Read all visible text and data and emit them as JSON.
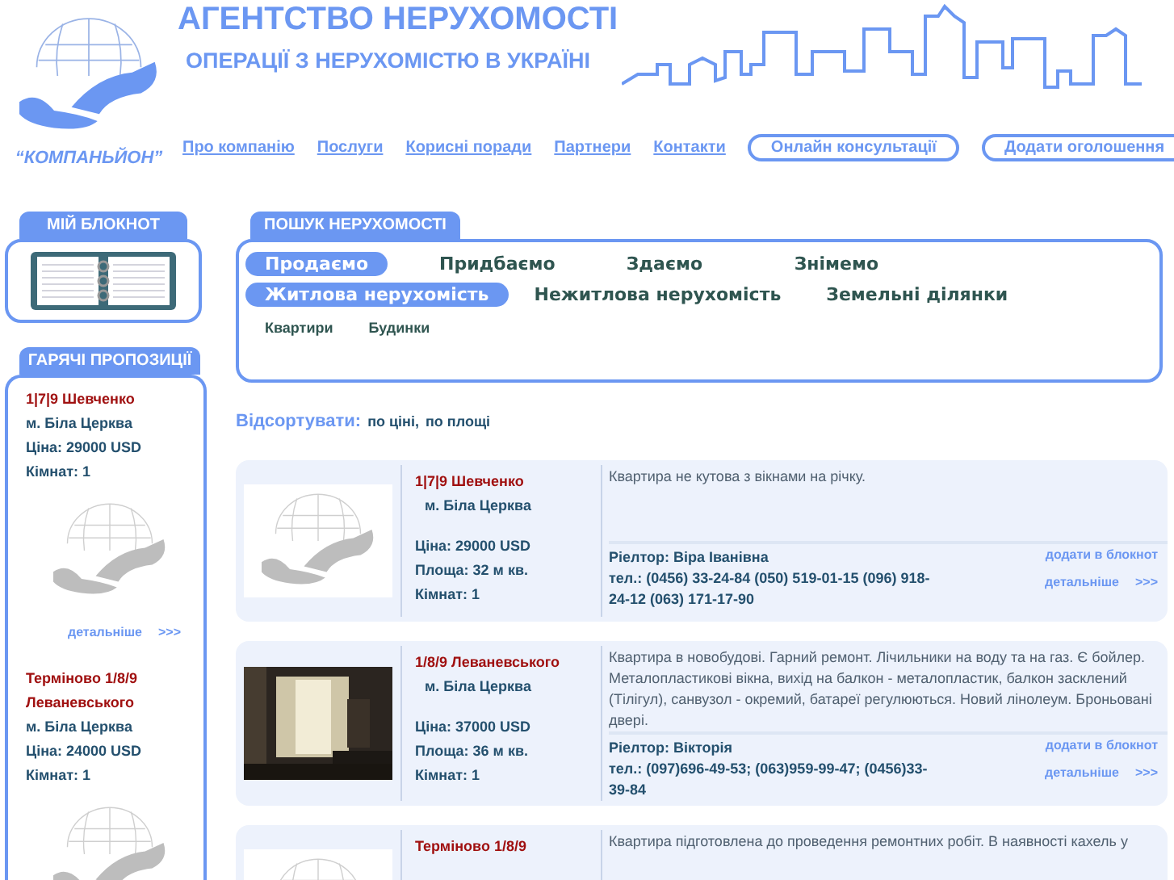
{
  "header": {
    "logo_text": "“КОМПАНЬЙОН”",
    "title": "АГЕНТСТВО НЕРУХОМОСТІ",
    "subtitle": "ОПЕРАЦІЇ З НЕРУХОМІСТЮ В УКРАЇНІ",
    "nav": [
      "Про компанію",
      "Послуги",
      "Корисні поради",
      "Партнери",
      "Контакти"
    ],
    "buttons": [
      "Онлайн консультації",
      "Додати оголошення"
    ]
  },
  "notebook": {
    "title": "МІЙ БЛОКНОТ"
  },
  "hot": {
    "title": "ГАРЯЧІ ПРОПОЗИЦІЇ",
    "items": [
      {
        "title": "1|7|9 Шевченко",
        "city": "м. Біла Церква",
        "price": "Ціна: 29000 USD",
        "rooms": "Кімнат: 1",
        "kind": "placeholder",
        "more": "детальніше",
        "arrows": ">>>"
      },
      {
        "title": "Терміново 1/8/9 Леваневського",
        "city": "м. Біла Церква",
        "price": "Ціна: 24000 USD",
        "rooms": "Кімнат: 1",
        "kind": "placeholder"
      }
    ]
  },
  "search": {
    "title": "ПОШУК НЕРУХОМОСТІ",
    "deals": [
      {
        "label": "Продаємо",
        "selected": true
      },
      {
        "label": "Придбаємо",
        "selected": false
      },
      {
        "label": "Здаємо",
        "selected": false
      },
      {
        "label": "Знімемо",
        "selected": false
      }
    ],
    "types": [
      {
        "label": "Житлова нерухомість",
        "selected": true
      },
      {
        "label": "Нежитлова нерухомість",
        "selected": false
      },
      {
        "label": "Земельні ділянки",
        "selected": false
      }
    ],
    "subtypes": [
      "Квартири",
      "Будинки"
    ]
  },
  "sort": {
    "label": "Відсортувати:",
    "options": [
      "по ціні,",
      "по площі"
    ]
  },
  "listings": [
    {
      "kind": "placeholder",
      "title": "1|7|9 Шевченко",
      "city": "м. Біла Церква",
      "price": "Ціна: 29000 USD",
      "area": "Площа: 32 м кв.",
      "rooms": "Кімнат: 1",
      "description": "Квартира не кутова з вікнами на річку.",
      "realtor": "Ріелтор: Віра Іванівна",
      "phone": "тел.: (0456) 33-24-84 (050) 519-01-15 (096) 918-24-12 (063) 171-17-90",
      "notebook_link": "додати в блокнот",
      "more": "детальніше",
      "arrows": ">>>"
    },
    {
      "title": "1/8/9 Леваневського",
      "city": "м. Біла Церква",
      "price": "Ціна: 37000 USD",
      "area": "Площа: 36 м кв.",
      "rooms": "Кімнат: 1",
      "description": "Квартира в новобудові. Гарний ремонт. Лічильники на воду та на газ. Є бойлер. Металопластикові вікна, вихід на балкон - металопластик, балкон засклений (Тілігул), санвузол - окремий, батареї регулюються. Новий лінолеум. Броньовані двері.",
      "realtor": "Ріелтор: Вікторія",
      "phone": "тел.: (097)696-49-53; (063)959-99-47; (0456)33-39-84",
      "notebook_link": "додати в блокнот",
      "more": "детальніше",
      "arrows": ">>>"
    },
    {
      "kind": "placeholder",
      "title": "Терміново 1/8/9",
      "description": "Квартира підготовлена до проведення ремонтних робіт. В наявності кахель у"
    }
  ]
}
